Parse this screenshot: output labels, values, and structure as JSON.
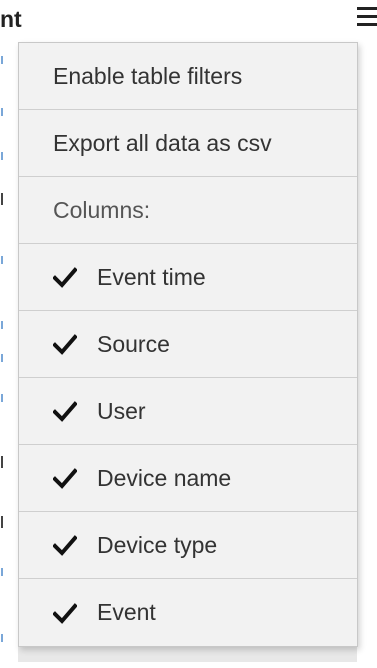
{
  "header": {
    "title_fragment": "nt",
    "menu_icon": "hamburger-menu-icon"
  },
  "menu": {
    "actions": [
      {
        "label": "Enable table filters"
      },
      {
        "label": "Export all data as csv"
      }
    ],
    "columns_heading": "Columns:",
    "columns": [
      {
        "label": "Event time",
        "checked": true,
        "icon": "checkmark-icon"
      },
      {
        "label": "Source",
        "checked": true,
        "icon": "checkmark-icon"
      },
      {
        "label": "User",
        "checked": true,
        "icon": "checkmark-icon"
      },
      {
        "label": "Device name",
        "checked": true,
        "icon": "checkmark-icon"
      },
      {
        "label": "Device type",
        "checked": true,
        "icon": "checkmark-icon"
      },
      {
        "label": "Event",
        "checked": true,
        "icon": "checkmark-icon"
      }
    ]
  },
  "colors": {
    "menu_background": "#f2f2f2",
    "divider": "#cfcfcf",
    "text": "#333333"
  }
}
